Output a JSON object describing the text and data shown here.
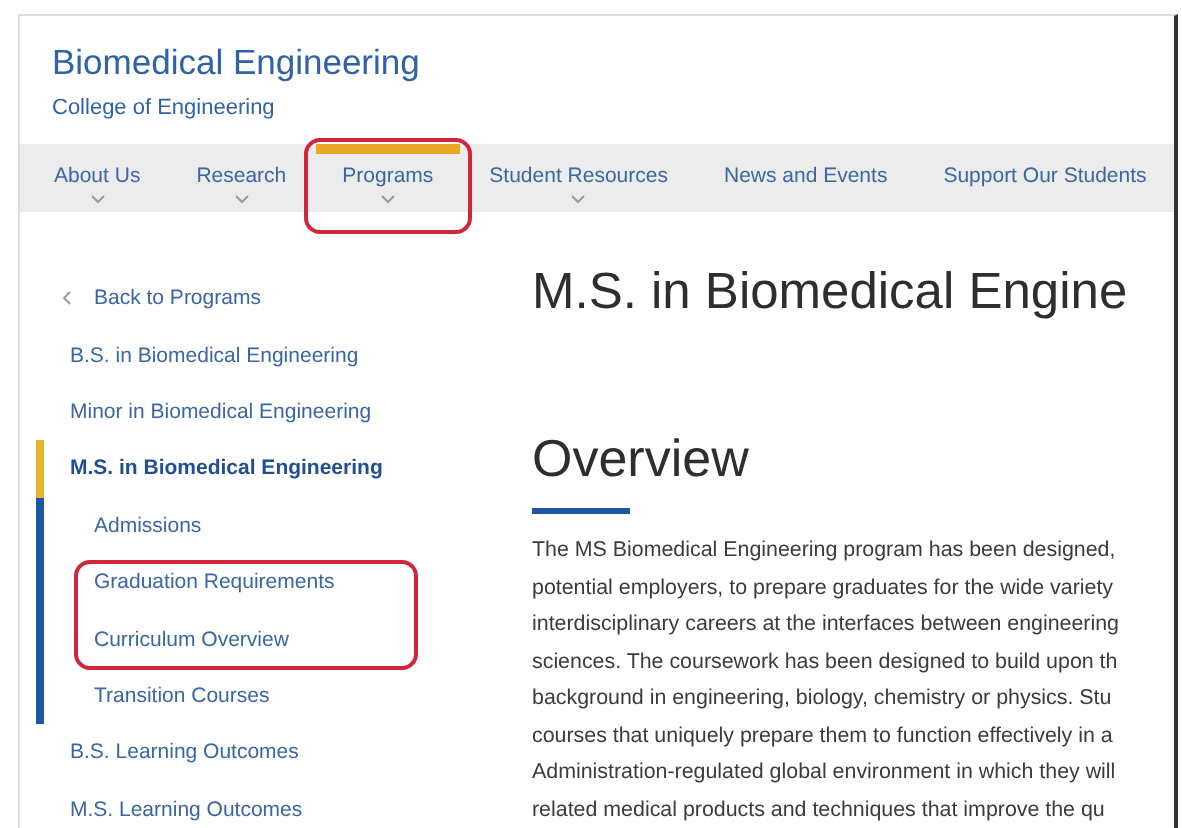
{
  "header": {
    "title": "Biomedical Engineering",
    "subtitle": "College of Engineering"
  },
  "nav": [
    {
      "label": "About Us",
      "dropdown": true,
      "selected": false
    },
    {
      "label": "Research",
      "dropdown": true,
      "selected": false
    },
    {
      "label": "Programs",
      "dropdown": true,
      "selected": true
    },
    {
      "label": "Student Resources",
      "dropdown": true,
      "selected": false
    },
    {
      "label": "News and Events",
      "dropdown": false,
      "selected": false
    },
    {
      "label": "Support Our Students",
      "dropdown": false,
      "selected": false
    }
  ],
  "sidebar": {
    "back": {
      "label": "Back to Programs"
    },
    "items": [
      {
        "label": "B.S. in Biomedical Engineering",
        "selected": false
      },
      {
        "label": "Minor in Biomedical Engineering",
        "selected": false
      },
      {
        "label": "M.S. in Biomedical Engineering",
        "selected": true,
        "children": [
          {
            "label": "Admissions"
          },
          {
            "label": "Graduation Requirements"
          },
          {
            "label": "Curriculum Overview"
          },
          {
            "label": "Transition Courses"
          }
        ]
      },
      {
        "label": "B.S. Learning Outcomes",
        "selected": false
      },
      {
        "label": "M.S. Learning Outcomes",
        "selected": false
      }
    ]
  },
  "main": {
    "title": "M.S. in Biomedical Engine",
    "section": "Overview",
    "paragraph_lines": [
      "The MS Biomedical Engineering program has been designed,",
      "potential employers, to prepare graduates for the wide variety",
      "interdisciplinary careers at the interfaces between engineering",
      "sciences. The coursework has been designed to build upon th",
      "background in engineering, biology, chemistry or physics. Stu",
      "courses that uniquely prepare them to function effectively in a",
      "Administration-regulated global environment in which they will",
      "related medical products and techniques that improve the qu"
    ]
  }
}
